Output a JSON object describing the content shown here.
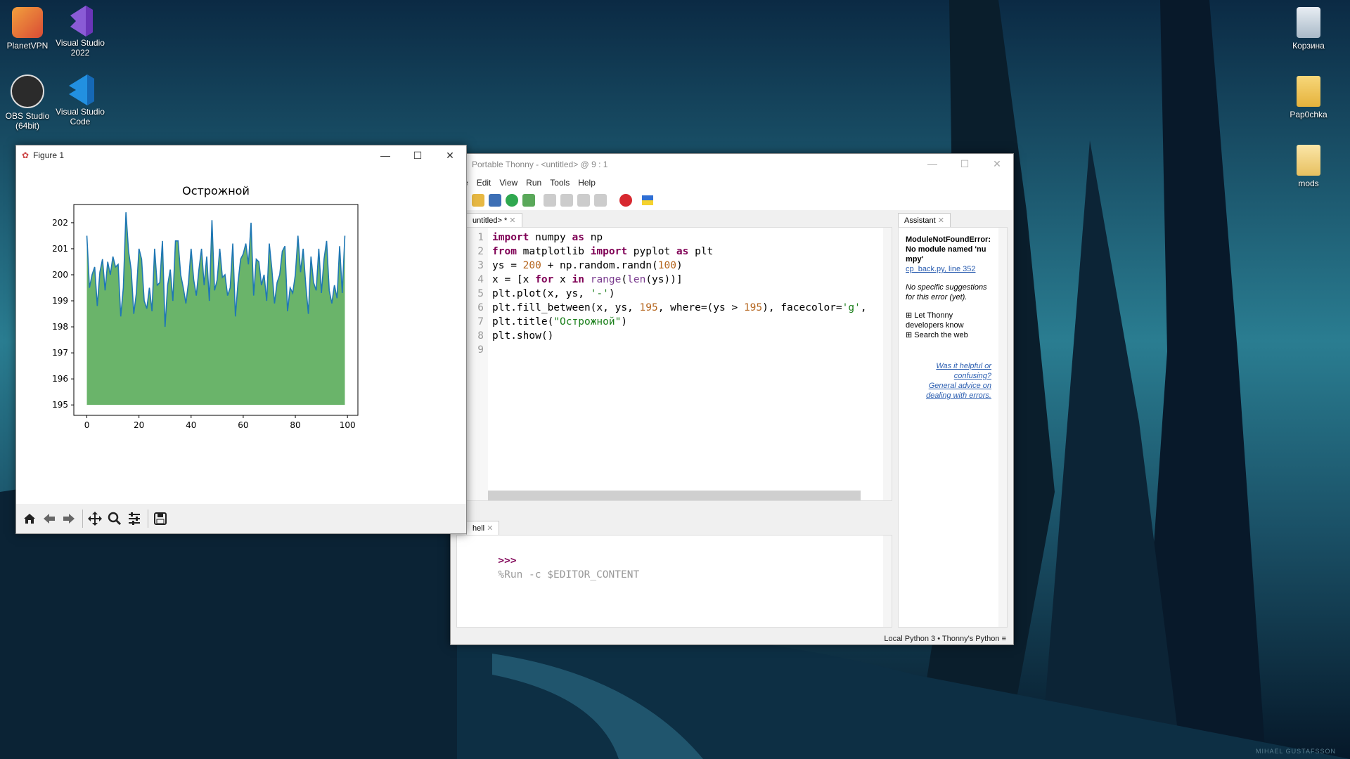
{
  "desktop": {
    "icons_left": [
      {
        "label": "PlanetVPN",
        "icon": "planetvpn-icon",
        "color": "#e0553a"
      },
      {
        "label": "Visual Studio 2022",
        "icon": "visual-studio-icon",
        "color": "#7a4cc4"
      },
      {
        "label": "OBS Studio (64bit)",
        "icon": "obs-icon",
        "color": "#2a2a2a"
      },
      {
        "label": "Visual Studio Code",
        "icon": "vscode-icon",
        "color": "#1f8ad8"
      }
    ],
    "icons_right": [
      {
        "label": "Корзина",
        "icon": "recycle-bin-icon"
      },
      {
        "label": "Pap0chka",
        "icon": "folder-icon"
      },
      {
        "label": "mods",
        "icon": "folder-icon"
      }
    ],
    "watermark": "MIHAEL GUSTAFSSON"
  },
  "figure_window": {
    "title": "Figure 1",
    "minimize": "—",
    "maximize": "☐",
    "close": "✕",
    "toolbar": [
      "home-icon",
      "back-icon",
      "forward-icon",
      "pan-icon",
      "zoom-icon",
      "configure-icon",
      "save-icon"
    ]
  },
  "chart_data": {
    "type": "area",
    "title": "Острожной",
    "xlabel": "",
    "ylabel": "",
    "xlim": [
      -5,
      104
    ],
    "ylim": [
      194.6,
      202.7
    ],
    "xticks": [
      0,
      20,
      40,
      60,
      80,
      100
    ],
    "yticks": [
      195,
      196,
      197,
      198,
      199,
      200,
      201,
      202
    ],
    "baseline": 195,
    "line_color": "#1f77b4",
    "fill_color": "#6ab46a",
    "x": [
      0,
      1,
      2,
      3,
      4,
      5,
      6,
      7,
      8,
      9,
      10,
      11,
      12,
      13,
      14,
      15,
      16,
      17,
      18,
      19,
      20,
      21,
      22,
      23,
      24,
      25,
      26,
      27,
      28,
      29,
      30,
      31,
      32,
      33,
      34,
      35,
      36,
      37,
      38,
      39,
      40,
      41,
      42,
      43,
      44,
      45,
      46,
      47,
      48,
      49,
      50,
      51,
      52,
      53,
      54,
      55,
      56,
      57,
      58,
      59,
      60,
      61,
      62,
      63,
      64,
      65,
      66,
      67,
      68,
      69,
      70,
      71,
      72,
      73,
      74,
      75,
      76,
      77,
      78,
      79,
      80,
      81,
      82,
      83,
      84,
      85,
      86,
      87,
      88,
      89,
      90,
      91,
      92,
      93,
      94,
      95,
      96,
      97,
      98,
      99
    ],
    "values": [
      201.5,
      199.5,
      200.0,
      200.3,
      198.8,
      200.1,
      200.6,
      199.4,
      200.5,
      200.0,
      200.7,
      200.3,
      200.4,
      198.4,
      199.5,
      202.4,
      200.9,
      200.2,
      198.5,
      199.3,
      201.0,
      200.6,
      199.0,
      198.7,
      199.5,
      198.6,
      201.0,
      199.6,
      199.7,
      201.3,
      198.0,
      199.6,
      200.2,
      199.0,
      201.3,
      201.3,
      200.0,
      199.5,
      198.9,
      199.7,
      201.0,
      199.8,
      199.2,
      200.2,
      201.0,
      199.6,
      200.7,
      199.0,
      202.1,
      199.4,
      199.8,
      201.0,
      199.9,
      200.0,
      199.2,
      199.5,
      201.2,
      198.4,
      199.7,
      200.6,
      200.8,
      201.2,
      200.4,
      202.0,
      199.2,
      200.6,
      200.5,
      199.6,
      200.0,
      199.0,
      201.2,
      200.2,
      198.9,
      199.7,
      200.0,
      200.9,
      201.1,
      198.6,
      199.5,
      199.3,
      200.0,
      201.5,
      200.1,
      201.0,
      199.6,
      198.5,
      200.7,
      199.7,
      199.4,
      201.0,
      199.3,
      200.6,
      201.3,
      199.4,
      198.9,
      199.6,
      199.1,
      201.1,
      199.3,
      201.5
    ]
  },
  "thonny": {
    "title": "Portable Thonny  -  <untitled>  @  9 : 1",
    "menu": [
      "e",
      "Edit",
      "View",
      "Run",
      "Tools",
      "Help"
    ],
    "editor_tab": "untitled> *",
    "shell_tab": "hell",
    "assistant_tab": "Assistant",
    "line_numbers": [
      "1",
      "2",
      "3",
      "4",
      "5",
      "6",
      "7",
      "8",
      "9"
    ],
    "code": [
      [
        {
          "t": "import",
          "c": "kw"
        },
        {
          "t": " numpy ",
          "c": ""
        },
        {
          "t": "as",
          "c": "kw"
        },
        {
          "t": " np",
          "c": ""
        }
      ],
      [
        {
          "t": "from",
          "c": "kw"
        },
        {
          "t": " matplotlib ",
          "c": ""
        },
        {
          "t": "import",
          "c": "kw"
        },
        {
          "t": " pyplot ",
          "c": ""
        },
        {
          "t": "as",
          "c": "kw"
        },
        {
          "t": " plt",
          "c": ""
        }
      ],
      [
        {
          "t": "ys = ",
          "c": ""
        },
        {
          "t": "200",
          "c": "num"
        },
        {
          "t": " + np.random.randn(",
          "c": ""
        },
        {
          "t": "100",
          "c": "num"
        },
        {
          "t": ")",
          "c": ""
        }
      ],
      [
        {
          "t": "x = [x ",
          "c": ""
        },
        {
          "t": "for",
          "c": "kw"
        },
        {
          "t": " x ",
          "c": ""
        },
        {
          "t": "in",
          "c": "kw"
        },
        {
          "t": " ",
          "c": ""
        },
        {
          "t": "range",
          "c": "builtin"
        },
        {
          "t": "(",
          "c": ""
        },
        {
          "t": "len",
          "c": "builtin"
        },
        {
          "t": "(ys))]",
          "c": ""
        }
      ],
      [
        {
          "t": "plt.plot(x, ys, ",
          "c": ""
        },
        {
          "t": "'-'",
          "c": "str"
        },
        {
          "t": ")",
          "c": ""
        }
      ],
      [
        {
          "t": "plt.fill_between(x, ys, ",
          "c": ""
        },
        {
          "t": "195",
          "c": "num"
        },
        {
          "t": ", where=(ys > ",
          "c": ""
        },
        {
          "t": "195",
          "c": "num"
        },
        {
          "t": "), facecolor=",
          "c": ""
        },
        {
          "t": "'g'",
          "c": "str"
        },
        {
          "t": ",",
          "c": ""
        }
      ],
      [
        {
          "t": "plt.title(",
          "c": ""
        },
        {
          "t": "\"Острожной\"",
          "c": "str"
        },
        {
          "t": ")",
          "c": ""
        }
      ],
      [
        {
          "t": "plt.show()",
          "c": ""
        }
      ],
      [
        {
          "t": "",
          "c": ""
        }
      ]
    ],
    "shell_prompt": ">>>",
    "shell_command": "%Run -c $EDITOR_CONTENT",
    "assistant": {
      "error": "ModuleNotFoundError: No module named 'numpy'",
      "link": "cp_back.py, line 352",
      "no_suggestions": "No specific suggestions for this error (yet).",
      "expand1": "Let Thonny developers know",
      "expand2": "Search the web",
      "feedback1": "Was it helpful or confusing?",
      "feedback2": "General advice on dealing with errors."
    },
    "status": "Local Python 3  •  Thonny's Python  ≡"
  }
}
